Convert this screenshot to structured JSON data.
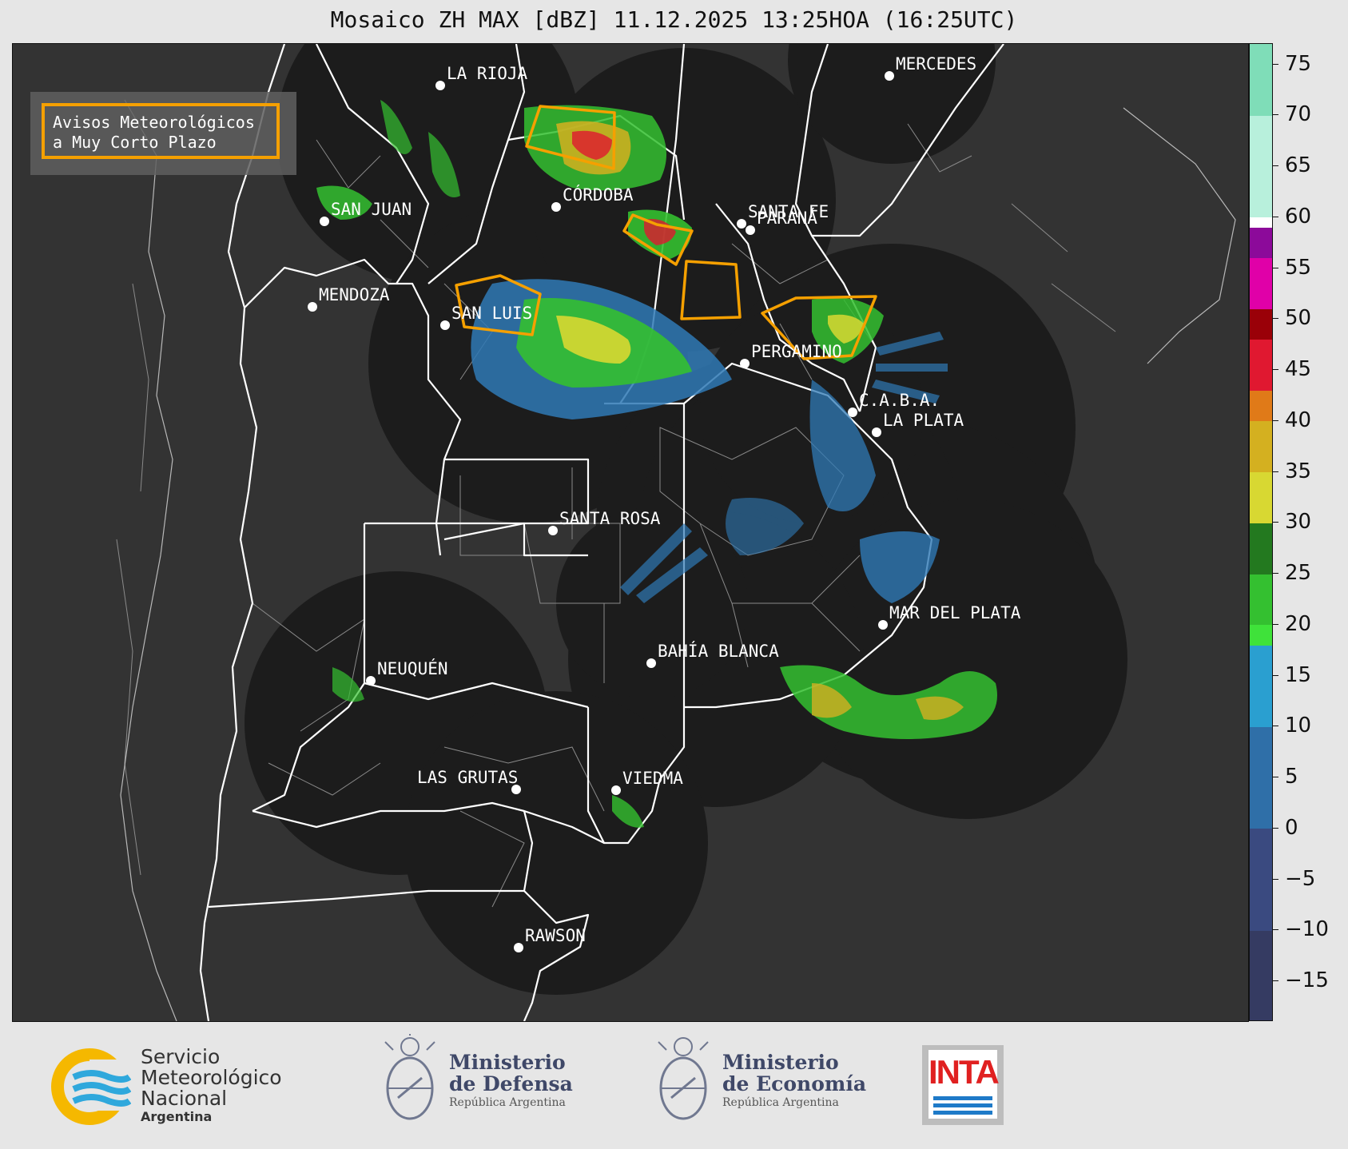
{
  "title": "Mosaico ZH MAX [dBZ] 11.12.2025 13:25HOA (16:25UTC)",
  "legend": {
    "line1": "Avisos Meteorológicos",
    "line2": "a Muy Corto Plazo",
    "border_color": "#f5a000"
  },
  "cities": [
    {
      "name": "LA RIOJA"
    },
    {
      "name": "SAN JUAN"
    },
    {
      "name": "CÓRDOBA"
    },
    {
      "name": "SANTA FE"
    },
    {
      "name": "PARANÁ"
    },
    {
      "name": "MENDOZA"
    },
    {
      "name": "SAN LUIS"
    },
    {
      "name": "PERGAMINO"
    },
    {
      "name": "C.A.B.A."
    },
    {
      "name": "LA PLATA"
    },
    {
      "name": "SANTA ROSA"
    },
    {
      "name": "MAR DEL PLATA"
    },
    {
      "name": "BAHÍA BLANCA"
    },
    {
      "name": "NEUQUÉN"
    },
    {
      "name": "LAS GRUTAS"
    },
    {
      "name": "VIEDMA"
    },
    {
      "name": "RAWSON"
    },
    {
      "name": "MERCEDES"
    }
  ],
  "colorbar": {
    "range_dbz": [
      -19,
      77
    ],
    "tick_labels": [
      "75",
      "70",
      "65",
      "60",
      "55",
      "50",
      "45",
      "40",
      "35",
      "30",
      "25",
      "20",
      "15",
      "10",
      "5",
      "0",
      "−5",
      "−10",
      "−15"
    ],
    "tick_values": [
      75,
      70,
      65,
      60,
      55,
      50,
      45,
      40,
      35,
      30,
      25,
      20,
      15,
      10,
      5,
      0,
      -5,
      -10,
      -15
    ],
    "bands": [
      {
        "from": -19,
        "to": -10,
        "color": "#353b62"
      },
      {
        "from": -10,
        "to": 0,
        "color": "#3a4a80"
      },
      {
        "from": 0,
        "to": 10,
        "color": "#2f6fa8"
      },
      {
        "from": 10,
        "to": 18,
        "color": "#2a9fd0"
      },
      {
        "from": 18,
        "to": 20,
        "color": "#3fe23a"
      },
      {
        "from": 20,
        "to": 25,
        "color": "#34c030"
      },
      {
        "from": 25,
        "to": 30,
        "color": "#23791f"
      },
      {
        "from": 30,
        "to": 35,
        "color": "#d8d832"
      },
      {
        "from": 35,
        "to": 40,
        "color": "#d4b020"
      },
      {
        "from": 40,
        "to": 43,
        "color": "#e07a18"
      },
      {
        "from": 43,
        "to": 48,
        "color": "#e01830"
      },
      {
        "from": 48,
        "to": 51,
        "color": "#9a0008"
      },
      {
        "from": 51,
        "to": 56,
        "color": "#e000a8"
      },
      {
        "from": 56,
        "to": 59,
        "color": "#8c0a9a"
      },
      {
        "from": 59,
        "to": 60,
        "color": "#ffffff"
      },
      {
        "from": 60,
        "to": 70,
        "color": "#b8f0dc"
      },
      {
        "from": 70,
        "to": 77,
        "color": "#7fddb8"
      }
    ]
  },
  "footer": {
    "smn": {
      "line1": "Servicio",
      "line2": "Meteorológico",
      "line3": "Nacional",
      "country": "Argentina"
    },
    "defensa": {
      "line1": "Ministerio",
      "line2": "de Defensa",
      "line3": "República Argentina"
    },
    "economia": {
      "line1": "Ministerio",
      "line2": "de Economía",
      "line3": "República Argentina"
    },
    "inta": "INTA"
  }
}
